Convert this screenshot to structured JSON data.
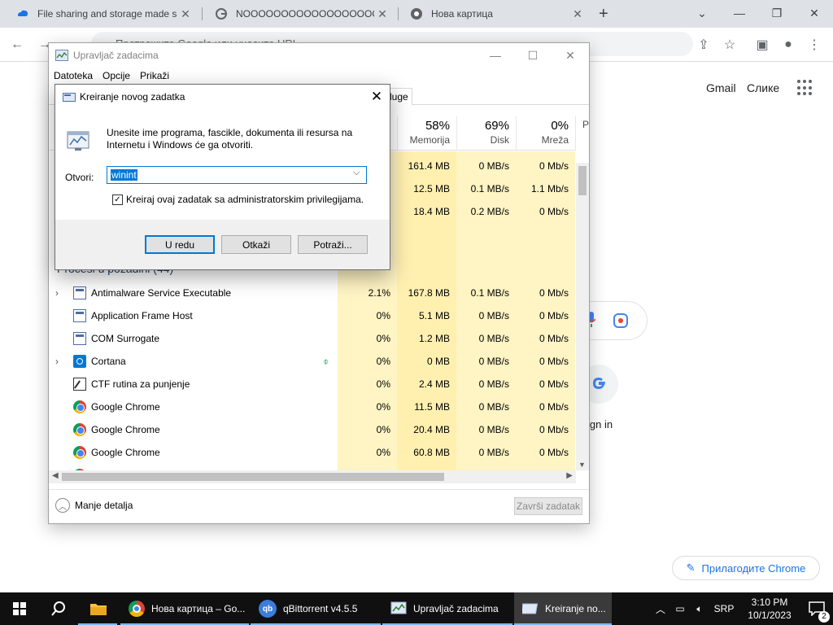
{
  "browser": {
    "tabs": [
      {
        "title": "File sharing and storage made s",
        "favicon": "cloud-icon"
      },
      {
        "title": "NOOOOOOOOOOOOOOOOOO",
        "favicon": "google-g-icon"
      },
      {
        "title": "Нова картица",
        "favicon": "chrome-icon"
      }
    ],
    "new_tab": "+",
    "omnibox_placeholder": "Претражите Google или унесите URL"
  },
  "ntp": {
    "gmail": "Gmail",
    "images": "Слике",
    "sign_in_partial": "ign in",
    "customize": "Прилагодите Chrome"
  },
  "taskmgr": {
    "title": "Upravljač zadacima",
    "menu": [
      "Datoteka",
      "Opcije",
      "Prikaži"
    ],
    "services_tab_partial": "luge",
    "columns": [
      {
        "pct": "58%",
        "label": "Memorija"
      },
      {
        "pct": "69%",
        "label": "Disk"
      },
      {
        "pct": "0%",
        "label": "Mreža"
      },
      {
        "pct": "",
        "label": "P"
      }
    ],
    "app_rows": [
      {
        "cpu": "",
        "memory": "161.4 MB",
        "disk": "0 MB/s",
        "network": "0 Mb/s"
      },
      {
        "cpu": "",
        "memory": "12.5 MB",
        "disk": "0.1 MB/s",
        "network": "1.1 Mb/s"
      },
      {
        "cpu": "",
        "memory": "18.4 MB",
        "disk": "0.2 MB/s",
        "network": "0 Mb/s"
      }
    ],
    "background_group": "Procesi u pozadini (44)",
    "rows": [
      {
        "name": "Antimalware Service Executable",
        "icon": "app-window-icon",
        "expand": true,
        "cpu": "2.1%",
        "memory": "167.8 MB",
        "disk": "0.1 MB/s",
        "network": "0 Mb/s"
      },
      {
        "name": "Application Frame Host",
        "icon": "app-window-icon",
        "expand": false,
        "cpu": "0%",
        "memory": "5.1 MB",
        "disk": "0 MB/s",
        "network": "0 Mb/s"
      },
      {
        "name": "COM Surrogate",
        "icon": "app-window-icon",
        "expand": false,
        "cpu": "0%",
        "memory": "1.2 MB",
        "disk": "0 MB/s",
        "network": "0 Mb/s"
      },
      {
        "name": "Cortana",
        "icon": "cortana-icon",
        "expand": true,
        "cpu": "0%",
        "memory": "0 MB",
        "disk": "0 MB/s",
        "network": "0 Mb/s",
        "leaf": true
      },
      {
        "name": "CTF rutina za punjenje",
        "icon": "ctf-pen-icon",
        "expand": false,
        "cpu": "0%",
        "memory": "2.4 MB",
        "disk": "0 MB/s",
        "network": "0 Mb/s"
      },
      {
        "name": "Google Chrome",
        "icon": "chrome-icon",
        "expand": false,
        "cpu": "0%",
        "memory": "11.5 MB",
        "disk": "0 MB/s",
        "network": "0 Mb/s"
      },
      {
        "name": "Google Chrome",
        "icon": "chrome-icon",
        "expand": false,
        "cpu": "0%",
        "memory": "20.4 MB",
        "disk": "0 MB/s",
        "network": "0 Mb/s"
      },
      {
        "name": "Google Chrome",
        "icon": "chrome-icon",
        "expand": false,
        "cpu": "0%",
        "memory": "60.8 MB",
        "disk": "0 MB/s",
        "network": "0 Mb/s"
      }
    ],
    "fewer_details": "Manje detalja",
    "end_task": "Završi zadatak"
  },
  "run_dialog": {
    "title": "Kreiranje novog zadatka",
    "description": "Unesite ime programa, fascikle, dokumenta ili resursa na Internetu i Windows će ga otvoriti.",
    "open_label": "Otvori:",
    "open_value": "winint",
    "admin_checkbox_label": "Kreiraj ovaj zadatak sa administratorskim privilegijama.",
    "admin_checked": true,
    "ok": "U redu",
    "cancel": "Otkaži",
    "browse": "Potraži..."
  },
  "taskbar": {
    "items": [
      {
        "label": "Нова картица – Go...",
        "icon": "chrome-icon"
      },
      {
        "label": "qBittorrent v4.5.5",
        "icon": "qbittorrent-icon"
      },
      {
        "label": "Upravljač zadacima",
        "icon": "task-manager-icon"
      },
      {
        "label": "Kreiranje no...",
        "icon": "run-dialog-icon"
      }
    ],
    "language": "SRP",
    "time": "3:10 PM",
    "date": "10/1/2023",
    "notifications": "2"
  },
  "colors": {
    "accent": "#0078d7",
    "heat_light": "#fff4c4",
    "taskbar": "#101010",
    "chrome_tabstrip": "#dee1e6"
  }
}
